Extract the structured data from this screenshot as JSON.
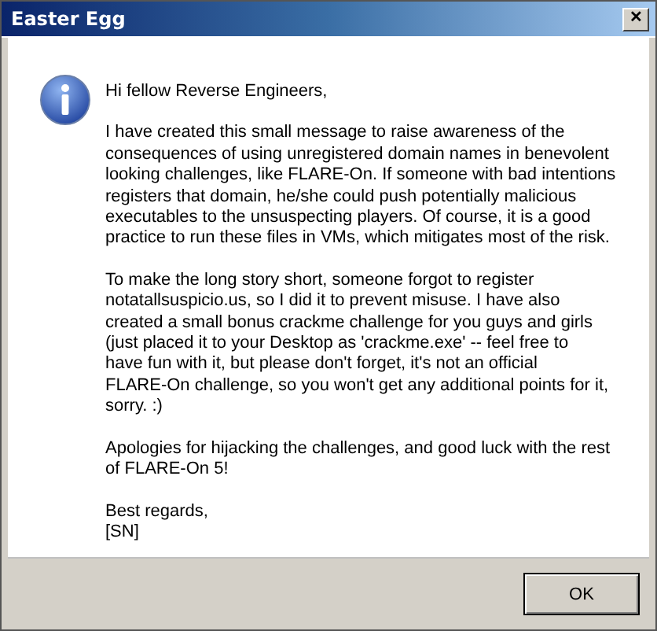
{
  "window": {
    "title": "Easter Egg",
    "close": "✕"
  },
  "message": {
    "paragraphs": [
      [
        "Hi fellow Reverse Engineers,"
      ],
      [
        "I have created this small message to raise awareness of the",
        "consequences of using unregistered domain names in benevolent",
        "looking challenges, like FLARE-On. If someone with bad intentions",
        "registers that domain, he/she could push potentially malicious",
        "executables to the unsuspecting players. Of course, it is a good",
        "practice to run these files in VMs, which mitigates most of the risk."
      ],
      [
        "To make the long story short, someone forgot to register",
        "notatallsuspicio.us, so I did it to prevent misuse. I have also",
        "created a small bonus crackme challenge for you guys and girls",
        "(just placed it to your Desktop as 'crackme.exe' -- feel free to",
        "have fun with it, but please don't forget, it's not an official",
        "FLARE-On challenge, so you won't get any additional points for it,",
        "sorry. :)"
      ],
      [
        "Apologies for hijacking the challenges, and good luck with the rest",
        "of FLARE-On 5!"
      ],
      [
        "Best regards,",
        "[SN]"
      ]
    ]
  },
  "buttons": [
    "OK"
  ]
}
